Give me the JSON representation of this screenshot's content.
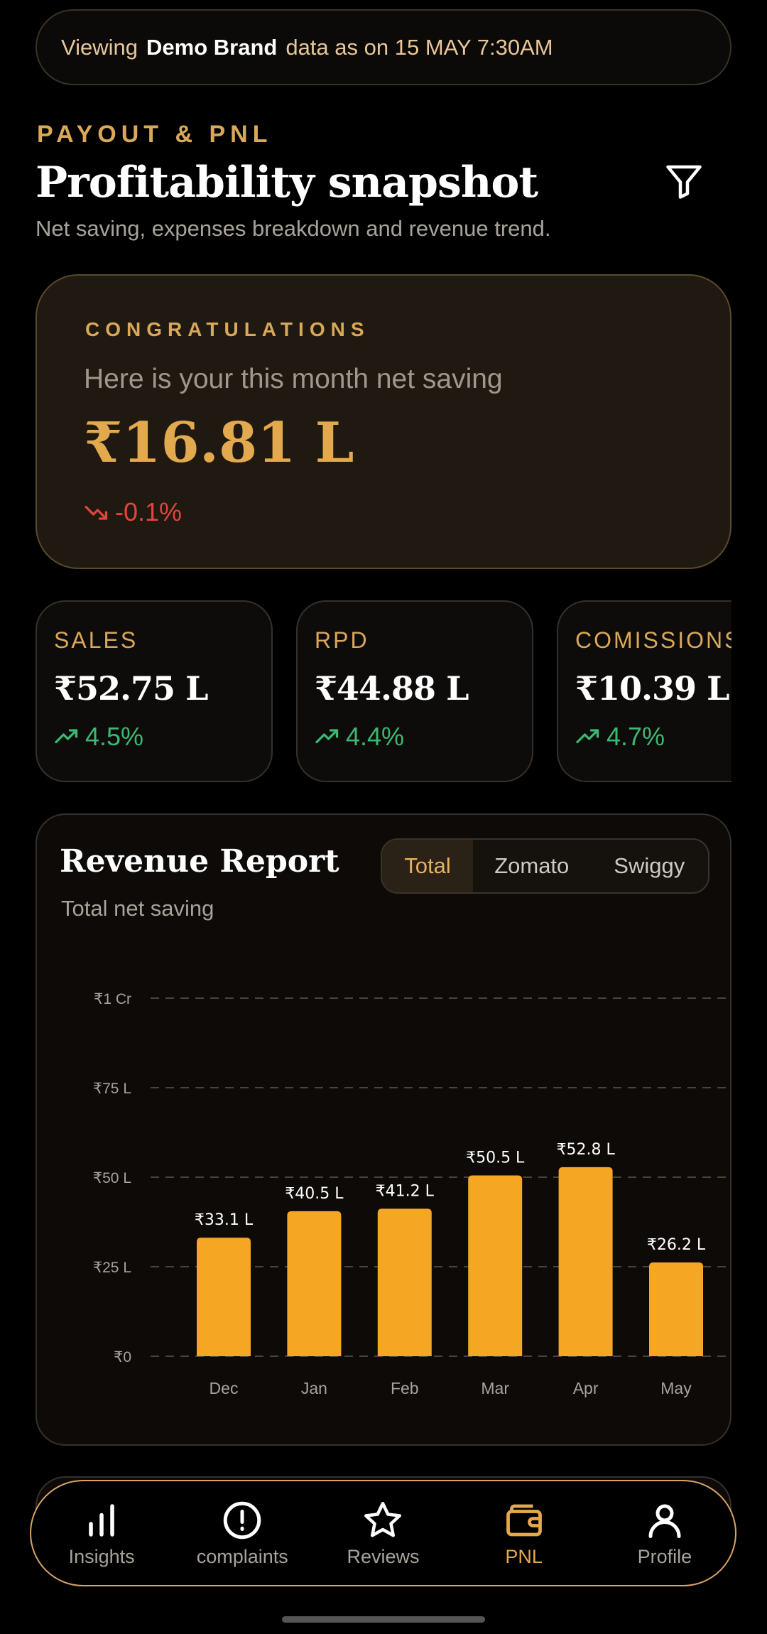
{
  "banner": {
    "prefix": "Viewing",
    "brand": "Demo Brand",
    "suffix": "data as on 15 MAY 7:30AM"
  },
  "header": {
    "eyebrow": "PAYOUT & PNL",
    "title": "Profitability snapshot",
    "subtitle": "Net saving, expenses breakdown and revenue trend.",
    "filter_icon": "filter-icon"
  },
  "hero": {
    "eyebrow": "CONGRATULATIONS",
    "description": "Here is your this month net saving",
    "amount": "₹16.81 L",
    "change": "-0.1%",
    "change_color": "#e0453e"
  },
  "kpis": [
    {
      "label": "SALES",
      "value": "₹52.75 L",
      "change": "4.5%"
    },
    {
      "label": "RPD",
      "value": "₹44.88 L",
      "change": "4.4%"
    },
    {
      "label": "COMISSIONS",
      "value": "₹10.39 L",
      "change": "4.7%"
    }
  ],
  "report": {
    "title": "Revenue Report",
    "subtitle": "Total net saving",
    "tabs": [
      "Total",
      "Zomato",
      "Swiggy"
    ],
    "active_tab": "Total"
  },
  "chart_data": {
    "type": "bar",
    "categories": [
      "Dec",
      "Jan",
      "Feb",
      "Mar",
      "Apr",
      "May"
    ],
    "values": [
      33.1,
      40.5,
      41.2,
      50.5,
      52.8,
      26.2
    ],
    "value_labels": [
      "₹33.1 L",
      "₹40.5 L",
      "₹41.2 L",
      "₹50.5 L",
      "₹52.8 L",
      "₹26.2 L"
    ],
    "yticks": [
      0,
      25,
      50,
      75,
      100
    ],
    "ytick_labels": [
      "₹0",
      "₹25 L",
      "₹50 L",
      "₹75 L",
      "₹1 Cr"
    ],
    "ylim": [
      0,
      100
    ],
    "grid": true,
    "bar_color": "#f5a623"
  },
  "nav": {
    "items": [
      {
        "label": "Insights",
        "icon": "bar-chart-icon"
      },
      {
        "label": "complaints",
        "icon": "alert-circle-icon"
      },
      {
        "label": "Reviews",
        "icon": "star-icon"
      },
      {
        "label": "PNL",
        "icon": "wallet-icon"
      },
      {
        "label": "Profile",
        "icon": "user-icon"
      }
    ],
    "active": "PNL"
  },
  "colors": {
    "accent": "#e3a94e",
    "positive": "#3bb872",
    "negative": "#e0453e",
    "background": "#000000"
  }
}
